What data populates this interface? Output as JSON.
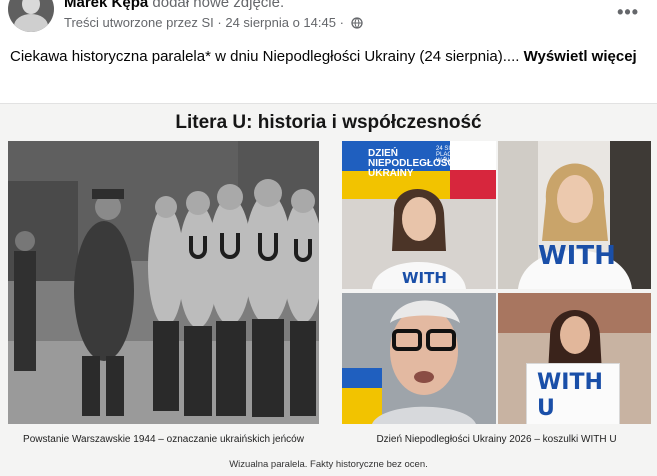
{
  "post": {
    "author": "Marek Kępa",
    "action": " dodał nowe zdjęcie.",
    "content_label": "Treści utworzone przez SI",
    "separator": " · ",
    "timestamp": "24 sierpnia o 14:45",
    "text": "Ciekawa historyczna paralela* w dniu Niepodległości Ukrainy (24 sierpnia)....",
    "see_more": "Wyświetl więcej"
  },
  "image": {
    "title": "Litera U: historia i współczesność",
    "banner_text": "DZIEŃ\nNIEPODLEGŁOŚCI\nUKRAINY",
    "banner_date": "24 SIERPNIA | 18:00\nPLAC ZAMKOWY\nW WARSZAWIE",
    "shirt_text": "WITH",
    "shirt_text_small": "WITH",
    "sign_text": "WITH\nU",
    "caption_left": "Powstanie Warszawskie 1944 – oznaczanie ukraińskich jeńców",
    "caption_right": "Dzień Niepodległości Ukrainy 2026 – koszulki WITH U",
    "footnote": "Wizualna paralela. Fakty historyczne bez ocen."
  },
  "icons": {
    "globe": "globe-icon",
    "more": "more-options-icon"
  },
  "colors": {
    "link": "#050505",
    "meta": "#65676b",
    "shirt_text": "#1a4fa8"
  }
}
